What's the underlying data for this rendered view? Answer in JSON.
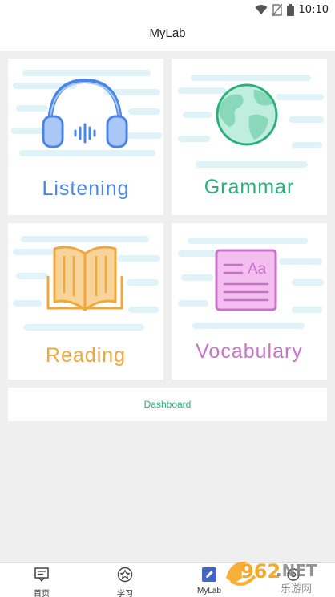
{
  "status_bar": {
    "time": "10:10",
    "icons": [
      "wifi-icon",
      "no-sim-icon",
      "battery-icon"
    ]
  },
  "app_bar": {
    "title": "MyLab"
  },
  "cards": [
    {
      "label": "Listening",
      "icon": "headphones-icon",
      "color": "#4a86e8"
    },
    {
      "label": "Grammar",
      "icon": "globe-icon",
      "color": "#2bb07c"
    },
    {
      "label": "Reading",
      "icon": "open-book-icon",
      "color": "#f0a83c"
    },
    {
      "label": "Vocabulary",
      "icon": "vocabulary-card-icon",
      "icon_text": "Aa",
      "color": "#c774c6"
    }
  ],
  "dashboard": {
    "label": "Dashboard"
  },
  "tab_bar": {
    "tabs": [
      {
        "label": "首页",
        "icon": "home-board-icon"
      },
      {
        "label": "学习",
        "icon": "star-circle-icon"
      },
      {
        "label": "MyLab",
        "icon": "pencil-icon",
        "active": true
      },
      {
        "label": "",
        "icon": "settings-icon"
      }
    ]
  },
  "watermark": {
    "text": "962.NET",
    "subtext": "乐游网"
  }
}
